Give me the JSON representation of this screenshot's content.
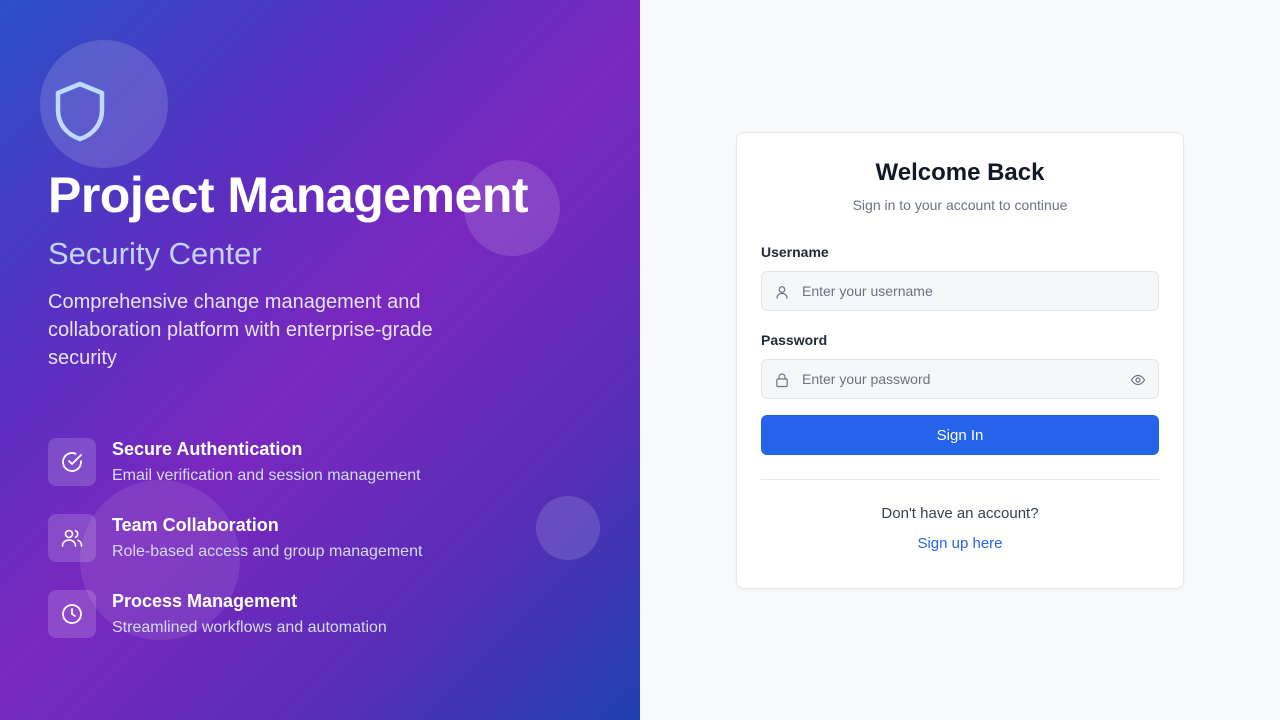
{
  "hero": {
    "title": "Project Management",
    "subtitle": "Security Center",
    "description": "Comprehensive change management and collaboration platform with enterprise-grade security",
    "logo_icon": "shield-icon",
    "features": [
      {
        "icon": "check-circle-icon",
        "title": "Secure Authentication",
        "description": "Email verification and session management"
      },
      {
        "icon": "users-icon",
        "title": "Team Collaboration",
        "description": "Role-based access and group management"
      },
      {
        "icon": "clock-icon",
        "title": "Process Management",
        "description": "Streamlined workflows and automation"
      }
    ]
  },
  "login": {
    "title": "Welcome Back",
    "subtitle": "Sign in to your account to continue",
    "username_label": "Username",
    "username_placeholder": "Enter your username",
    "username_value": "",
    "password_label": "Password",
    "password_placeholder": "Enter your password",
    "password_value": "",
    "submit_label": "Sign In",
    "no_account_text": "Don't have an account?",
    "signup_label": "Sign up here"
  },
  "colors": {
    "accent": "#2563eb",
    "gradient_start": "#2a4fc7",
    "gradient_mid": "#7a28bf",
    "gradient_end": "#1e40af",
    "page_background": "#f8f9fb"
  }
}
